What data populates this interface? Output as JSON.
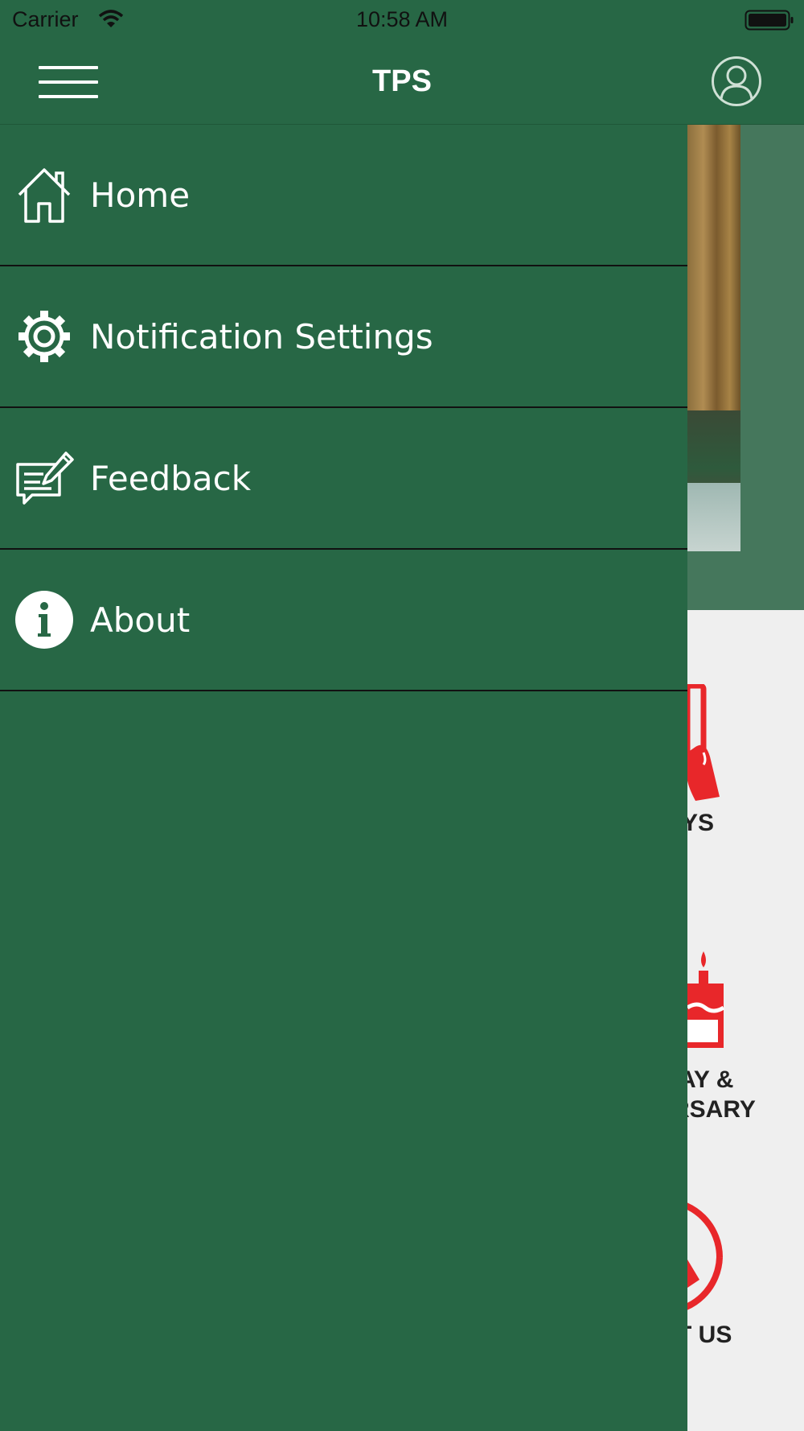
{
  "status_bar": {
    "carrier": "Carrier",
    "time": "10:58 AM"
  },
  "header": {
    "title": "TPS",
    "menu_icon": "hamburger-menu-icon",
    "profile_icon": "user-profile-icon"
  },
  "drawer": {
    "items": [
      {
        "label": "Home",
        "icon": "home-icon"
      },
      {
        "label": "Notification Settings",
        "icon": "gear-icon"
      },
      {
        "label": "Feedback",
        "icon": "feedback-icon"
      },
      {
        "label": "About",
        "icon": "info-icon"
      }
    ]
  },
  "background_page": {
    "tiles": [
      {
        "label_line1": "YS",
        "label_line2": ""
      },
      {
        "label_line1": "AY &",
        "label_line2": "RSARY"
      },
      {
        "label_line1": "T US",
        "label_line2": ""
      }
    ]
  },
  "colors": {
    "primary_green": "#276745",
    "accent_red": "#e8272a",
    "page_bg": "#efefef"
  }
}
